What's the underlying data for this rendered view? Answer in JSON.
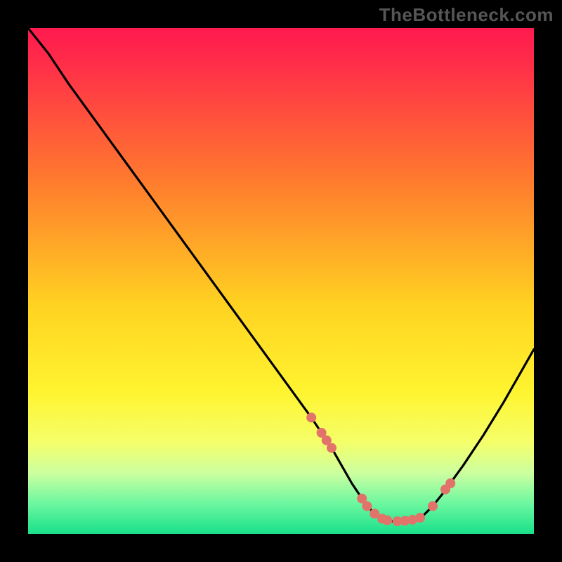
{
  "watermark": "TheBottleneck.com",
  "chart_data": {
    "type": "line",
    "title": "",
    "xlabel": "",
    "ylabel": "",
    "xlim": [
      0,
      100
    ],
    "ylim": [
      0,
      100
    ],
    "background_gradient": {
      "stops": [
        {
          "offset": 0.0,
          "color": "#ff1a4f"
        },
        {
          "offset": 0.06,
          "color": "#ff2a4a"
        },
        {
          "offset": 0.3,
          "color": "#ff7a2e"
        },
        {
          "offset": 0.55,
          "color": "#ffd321"
        },
        {
          "offset": 0.72,
          "color": "#fff430"
        },
        {
          "offset": 0.82,
          "color": "#f4ff6a"
        },
        {
          "offset": 0.88,
          "color": "#ccffa0"
        },
        {
          "offset": 0.94,
          "color": "#6cf7a0"
        },
        {
          "offset": 1.0,
          "color": "#19e08a"
        }
      ]
    },
    "series": [
      {
        "name": "bottleneck-curve",
        "x": [
          0.0,
          4.0,
          8.0,
          12.0,
          16.0,
          20.0,
          24.0,
          28.0,
          32.0,
          36.0,
          40.0,
          44.0,
          48.0,
          52.0,
          56.0,
          58.0,
          60.0,
          62.0,
          64.0,
          66.0,
          68.0,
          70.0,
          72.0,
          74.0,
          76.0,
          78.0,
          80.0,
          82.0,
          86.0,
          90.0,
          94.0,
          98.0,
          100.0
        ],
        "y": [
          100.0,
          95.0,
          89.0,
          83.5,
          78.0,
          72.5,
          67.0,
          61.5,
          56.0,
          50.5,
          45.0,
          39.5,
          34.0,
          28.5,
          23.0,
          20.0,
          17.0,
          13.5,
          10.0,
          7.0,
          4.5,
          3.0,
          2.5,
          2.5,
          2.8,
          3.5,
          5.5,
          8.0,
          13.5,
          19.5,
          26.0,
          33.0,
          36.5
        ]
      }
    ],
    "markers": {
      "name": "sample-dots",
      "color": "#e2736b",
      "points": [
        {
          "x": 56.0,
          "y": 23.0
        },
        {
          "x": 58.0,
          "y": 20.0
        },
        {
          "x": 59.0,
          "y": 18.5
        },
        {
          "x": 60.0,
          "y": 17.0
        },
        {
          "x": 66.0,
          "y": 7.0
        },
        {
          "x": 67.0,
          "y": 5.5
        },
        {
          "x": 68.5,
          "y": 4.0
        },
        {
          "x": 70.0,
          "y": 3.0
        },
        {
          "x": 71.0,
          "y": 2.7
        },
        {
          "x": 73.0,
          "y": 2.5
        },
        {
          "x": 74.5,
          "y": 2.6
        },
        {
          "x": 76.0,
          "y": 2.8
        },
        {
          "x": 77.5,
          "y": 3.2
        },
        {
          "x": 80.0,
          "y": 5.5
        },
        {
          "x": 82.5,
          "y": 8.8
        },
        {
          "x": 83.5,
          "y": 10.0
        }
      ]
    }
  }
}
